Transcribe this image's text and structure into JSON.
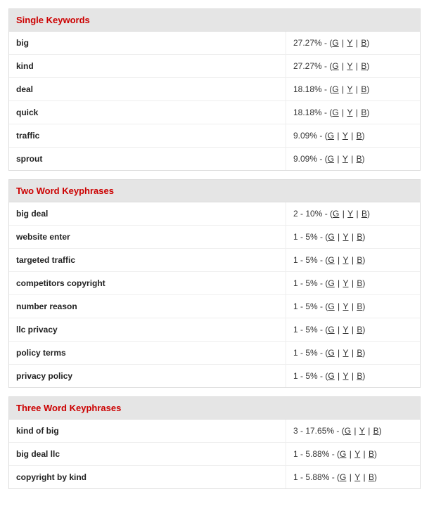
{
  "sections": [
    {
      "title": "Single Keywords",
      "rows": [
        {
          "keyword": "big",
          "stat": "27.27%"
        },
        {
          "keyword": "kind",
          "stat": "27.27%"
        },
        {
          "keyword": "deal",
          "stat": "18.18%"
        },
        {
          "keyword": "quick",
          "stat": "18.18%"
        },
        {
          "keyword": "traffic",
          "stat": "9.09%"
        },
        {
          "keyword": "sprout",
          "stat": "9.09%"
        }
      ]
    },
    {
      "title": "Two Word Keyphrases",
      "rows": [
        {
          "keyword": "big deal",
          "stat": "2 - 10%"
        },
        {
          "keyword": "website enter",
          "stat": "1 - 5%"
        },
        {
          "keyword": "targeted traffic",
          "stat": "1 - 5%"
        },
        {
          "keyword": "competitors copyright",
          "stat": "1 - 5%"
        },
        {
          "keyword": "number reason",
          "stat": "1 - 5%"
        },
        {
          "keyword": "llc privacy",
          "stat": "1 - 5%"
        },
        {
          "keyword": "policy terms",
          "stat": "1 - 5%"
        },
        {
          "keyword": "privacy policy",
          "stat": "1 - 5%"
        }
      ]
    },
    {
      "title": "Three Word Keyphrases",
      "rows": [
        {
          "keyword": "kind of big",
          "stat": "3 - 17.65%"
        },
        {
          "keyword": "big deal llc",
          "stat": "1 - 5.88%"
        },
        {
          "keyword": "copyright by kind",
          "stat": "1 - 5.88%"
        }
      ]
    }
  ],
  "links": {
    "g": "G",
    "y": "Y",
    "b": "B"
  },
  "separator": " - ",
  "paren_open": "(",
  "paren_close": ")",
  "pipe": " | "
}
